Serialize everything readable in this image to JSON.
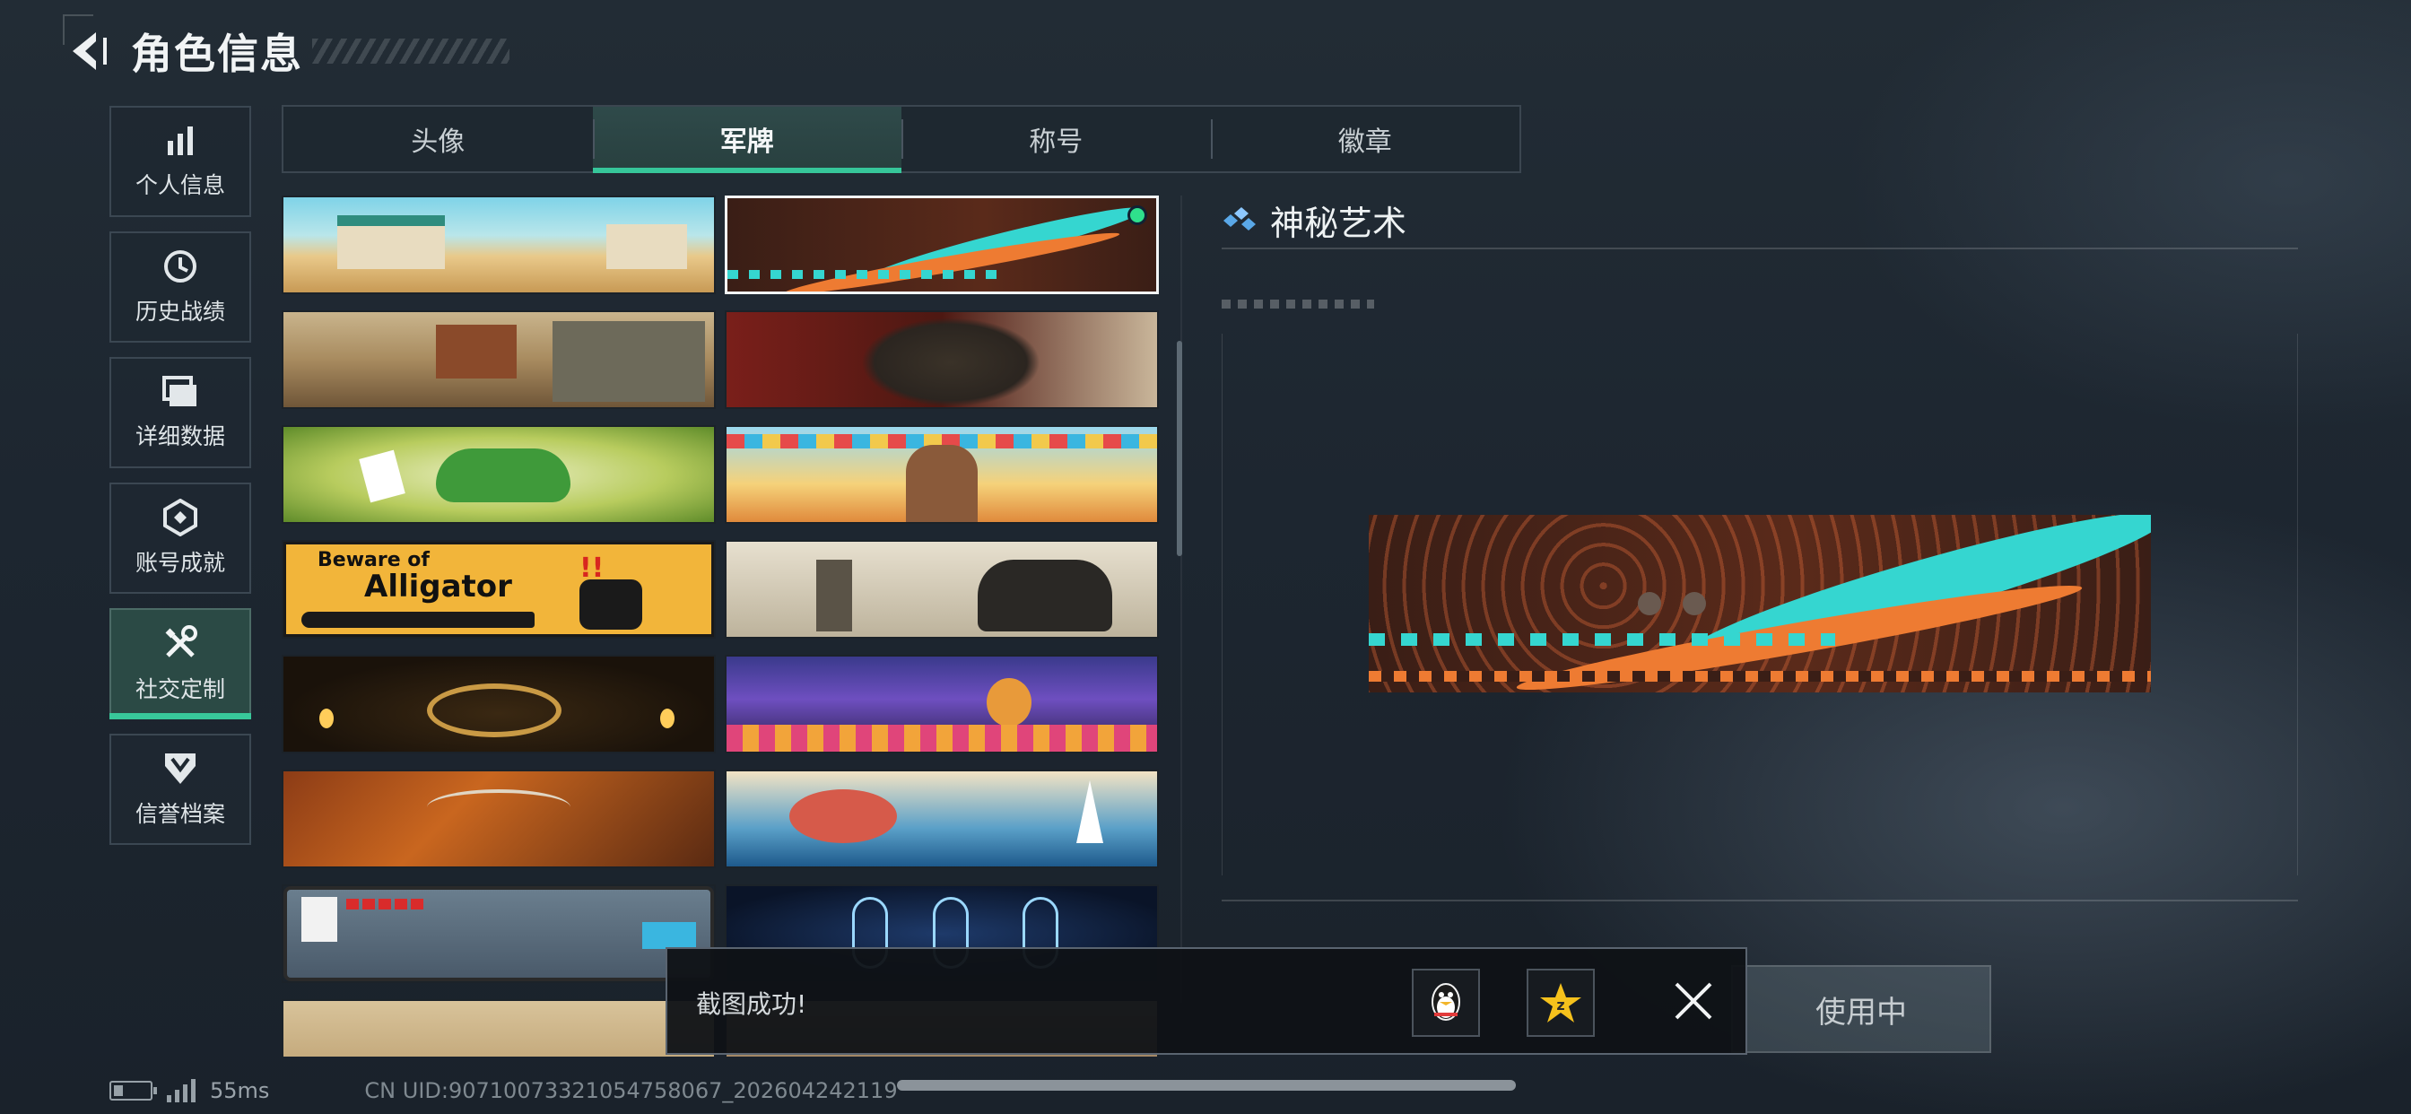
{
  "header": {
    "title": "角色信息",
    "back_icon": "back-arrow-icon"
  },
  "sidebar": {
    "items": [
      {
        "label": "个人信息",
        "icon": "bar-chart-icon",
        "active": false
      },
      {
        "label": "历史战绩",
        "icon": "history-clock-icon",
        "active": false
      },
      {
        "label": "详细数据",
        "icon": "folder-icon",
        "active": false
      },
      {
        "label": "账号成就",
        "icon": "achievement-badge-icon",
        "active": false
      },
      {
        "label": "社交定制",
        "icon": "wrench-tools-icon",
        "active": true
      },
      {
        "label": "信誉档案",
        "icon": "reputation-shield-icon",
        "active": false
      }
    ]
  },
  "tabs": [
    {
      "label": "头像",
      "active": false
    },
    {
      "label": "军牌",
      "active": true
    },
    {
      "label": "称号",
      "active": false
    },
    {
      "label": "徽章",
      "active": false
    }
  ],
  "cards": [
    {
      "name": "desert-villa",
      "text": ""
    },
    {
      "name": "tribal-feather",
      "text": "",
      "selected": true
    },
    {
      "name": "wild-west-town",
      "text": ""
    },
    {
      "name": "soldiers-squad",
      "text": ""
    },
    {
      "name": "cartoon-crocodile",
      "text": ""
    },
    {
      "name": "festival-chef",
      "text": ""
    },
    {
      "name": "beware-alligator",
      "text_top": "Beware of",
      "text_main": "Alligator"
    },
    {
      "name": "windmill-knight",
      "text": ""
    },
    {
      "name": "golden-peacock",
      "text": ""
    },
    {
      "name": "day-of-dead",
      "text": ""
    },
    {
      "name": "autumn-skeleton",
      "text": ""
    },
    {
      "name": "kraken-wave",
      "text": ""
    },
    {
      "name": "pixel-game",
      "text": ""
    },
    {
      "name": "xray-skeletons",
      "text": ""
    },
    {
      "name": "blueprint-sketch",
      "text": ""
    },
    {
      "name": "anime-room",
      "text": ""
    }
  ],
  "detail": {
    "title": "神秘艺术",
    "title_icon": "diamond-cluster-icon"
  },
  "use_button": {
    "label": "使用中"
  },
  "toast": {
    "message": "截图成功!",
    "share_qq_icon": "qq-penguin-icon",
    "share_qzone_icon": "qzone-star-icon",
    "close_icon": "close-x-icon"
  },
  "status": {
    "ping": "55ms",
    "uid": "CN UID:9071007332105475806​7_202604242119"
  },
  "colors": {
    "accent": "#36c69a",
    "selected_dot": "#2fe08c",
    "alligator_yellow": "#f2b53a"
  }
}
